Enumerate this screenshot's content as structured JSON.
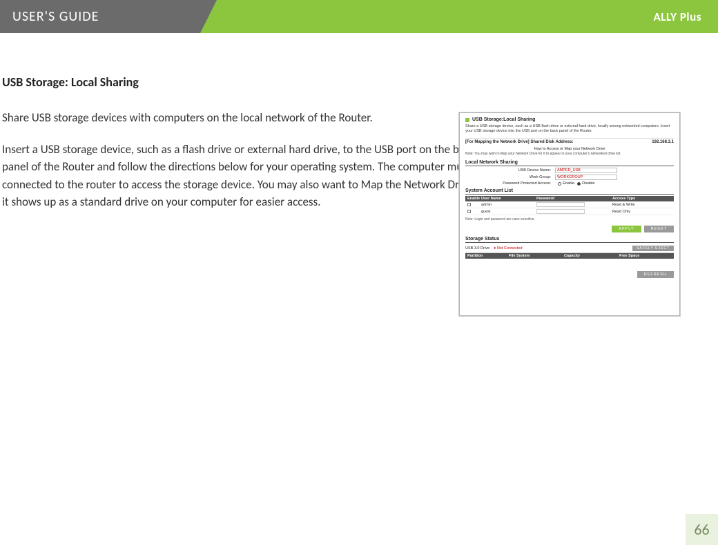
{
  "header": {
    "left_title": "USER'S GUIDE",
    "right_product": "ALLY Plus"
  },
  "section": {
    "title": "USB Storage: Local Sharing",
    "para1": "Share USB storage devices with computers on the local network of the Router.",
    "para2": "Insert a USB storage device, such as a flash drive or external hard drive, to the USB port on the back panel of the Router and follow the directions below for your operating system.  The computer must be connected to the router to access the storage device.  You may also want to Map the Network Drive so it shows up as a standard drive on your computer for easier access."
  },
  "figure": {
    "panel_title": "USB Storage:Local Sharing",
    "panel_desc": "Share a USB storage device, such as a USB flash drive or external hard drive, locally among networked computers. Insert your USB storage device into the USB port on the back panel of the Router.",
    "mapping_label": "[For Mapping the Network Drive] Shared Disk Address:",
    "mapping_ip": "192.168.3.1",
    "how_to": "How to Access or Map your Network Drive",
    "note_line": "Note: You may wish to Map your Network Drive for it to appear in your computer's networked drive list.",
    "section_ln": "Local Network Sharing",
    "form": {
      "usb_name_label": "USB Device Name:",
      "usb_name_value": "AMPED_USB",
      "workgroup_label": "Work Group:",
      "workgroup_value": "WORKGROUP",
      "pw_access_label": "Password Protected Access:",
      "enable_label": "Enable",
      "disable_label": "Disable"
    },
    "section_acct": "System Account List",
    "acct_headers": {
      "h1": "Enable",
      "h2": "User Name",
      "h3": "Password",
      "h4": "Access Type"
    },
    "acct_rows": [
      {
        "name": "admin",
        "access": "Read & Write"
      },
      {
        "name": "guest",
        "access": "Read Only"
      }
    ],
    "footnote": "Note: Login and password are case sensitive.",
    "btn_apply": "APPLY",
    "btn_reset": "RESET",
    "section_status": "Storage Status",
    "status_label": "USB 3.0 Drive:",
    "status_value": "Not Connected",
    "btn_eject": "SAFELY EJECT",
    "status_headers": {
      "h1": "Partition",
      "h2": "File System",
      "h3": "Capacity",
      "h4": "Free Space"
    },
    "btn_refresh": "REFRESH"
  },
  "page_number": "66"
}
